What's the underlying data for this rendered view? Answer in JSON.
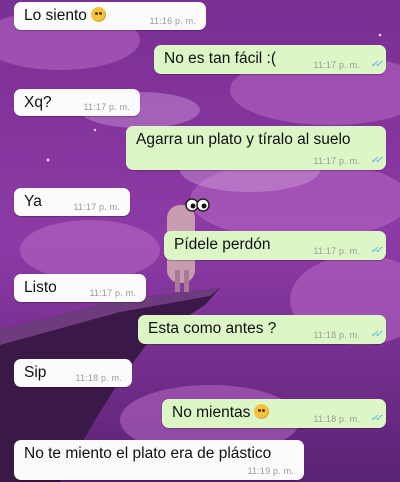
{
  "messages": [
    {
      "side": "in",
      "text": "Lo siento",
      "emoji": "pleading-face-icon",
      "time": "11:16 p. m."
    },
    {
      "side": "out",
      "text": "No es tan fácil :(",
      "time": "11:17 p. m."
    },
    {
      "side": "in",
      "text": "Xq?",
      "time": "11:17 p. m."
    },
    {
      "side": "out",
      "text": "Agarra un plato y tíralo al suelo",
      "time": "11:17 p. m."
    },
    {
      "side": "in",
      "text": "Ya",
      "time": "11:17 p. m."
    },
    {
      "side": "out",
      "text": "Pídele perdón",
      "time": "11:17 p. m."
    },
    {
      "side": "in",
      "text": "Listo",
      "time": "11:17 p. m."
    },
    {
      "side": "out",
      "text": "Esta como antes ?",
      "time": "11:18 p. m."
    },
    {
      "side": "in",
      "text": "Sip",
      "time": "11:18 p. m."
    },
    {
      "side": "out",
      "text": "No mientas",
      "emoji": "pensive-face-icon",
      "time": "11:18 p. m."
    },
    {
      "side": "in",
      "text": "No te miento el plato era de plástico",
      "time": "11:19 p. m."
    }
  ],
  "ticks": "✓✓",
  "colors": {
    "background": "#6a2b86",
    "incoming_bubble": "#fbfbfb",
    "outgoing_bubble": "#dcf6c6",
    "read_ticks": "#4fb4e6"
  }
}
